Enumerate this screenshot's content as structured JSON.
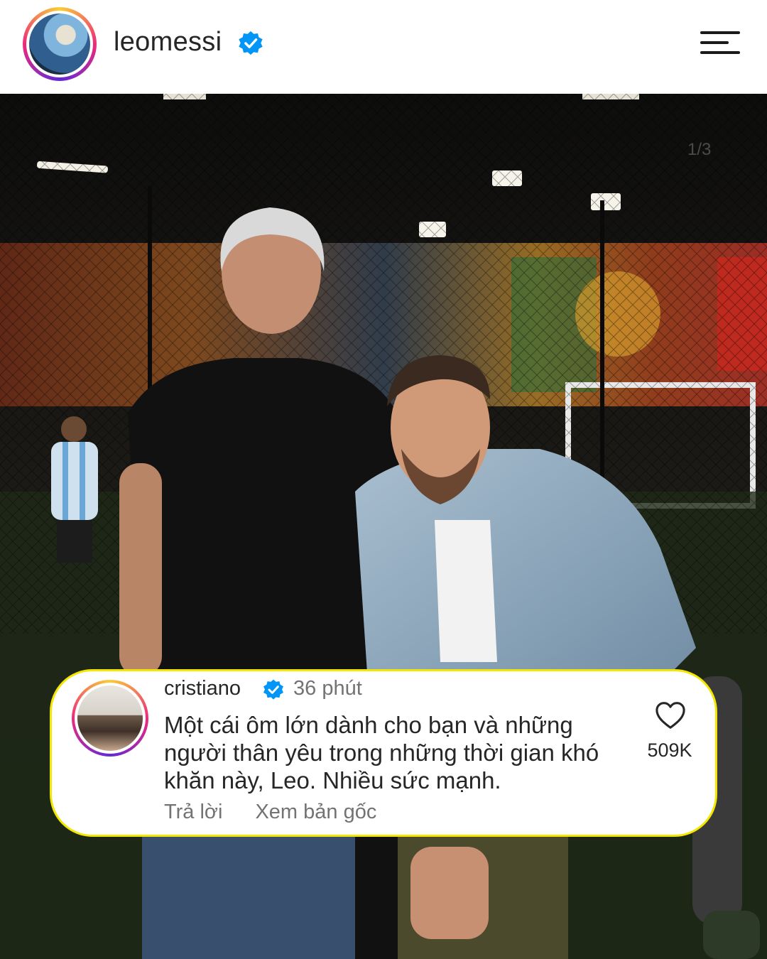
{
  "header": {
    "username": "leomessi",
    "verified_icon": "verified-badge-icon",
    "menu_icon": "hamburger-menu-icon"
  },
  "photo": {
    "counter": "1/3"
  },
  "comment": {
    "username": "cristiano",
    "time": "36 phút",
    "text": "Một cái ôm lớn dành cho bạn và những người thân yêu trong những thời gian khó khăn này, Leo. Nhiều sức mạnh.",
    "reply_label": "Trả lời",
    "see_original_label": "Xem bản gốc",
    "likes": "509K",
    "like_icon": "heart-icon"
  },
  "colors": {
    "verified": "#0095f6",
    "highlight_border": "#f3e600",
    "text_primary": "#262626",
    "text_secondary": "#737373"
  }
}
